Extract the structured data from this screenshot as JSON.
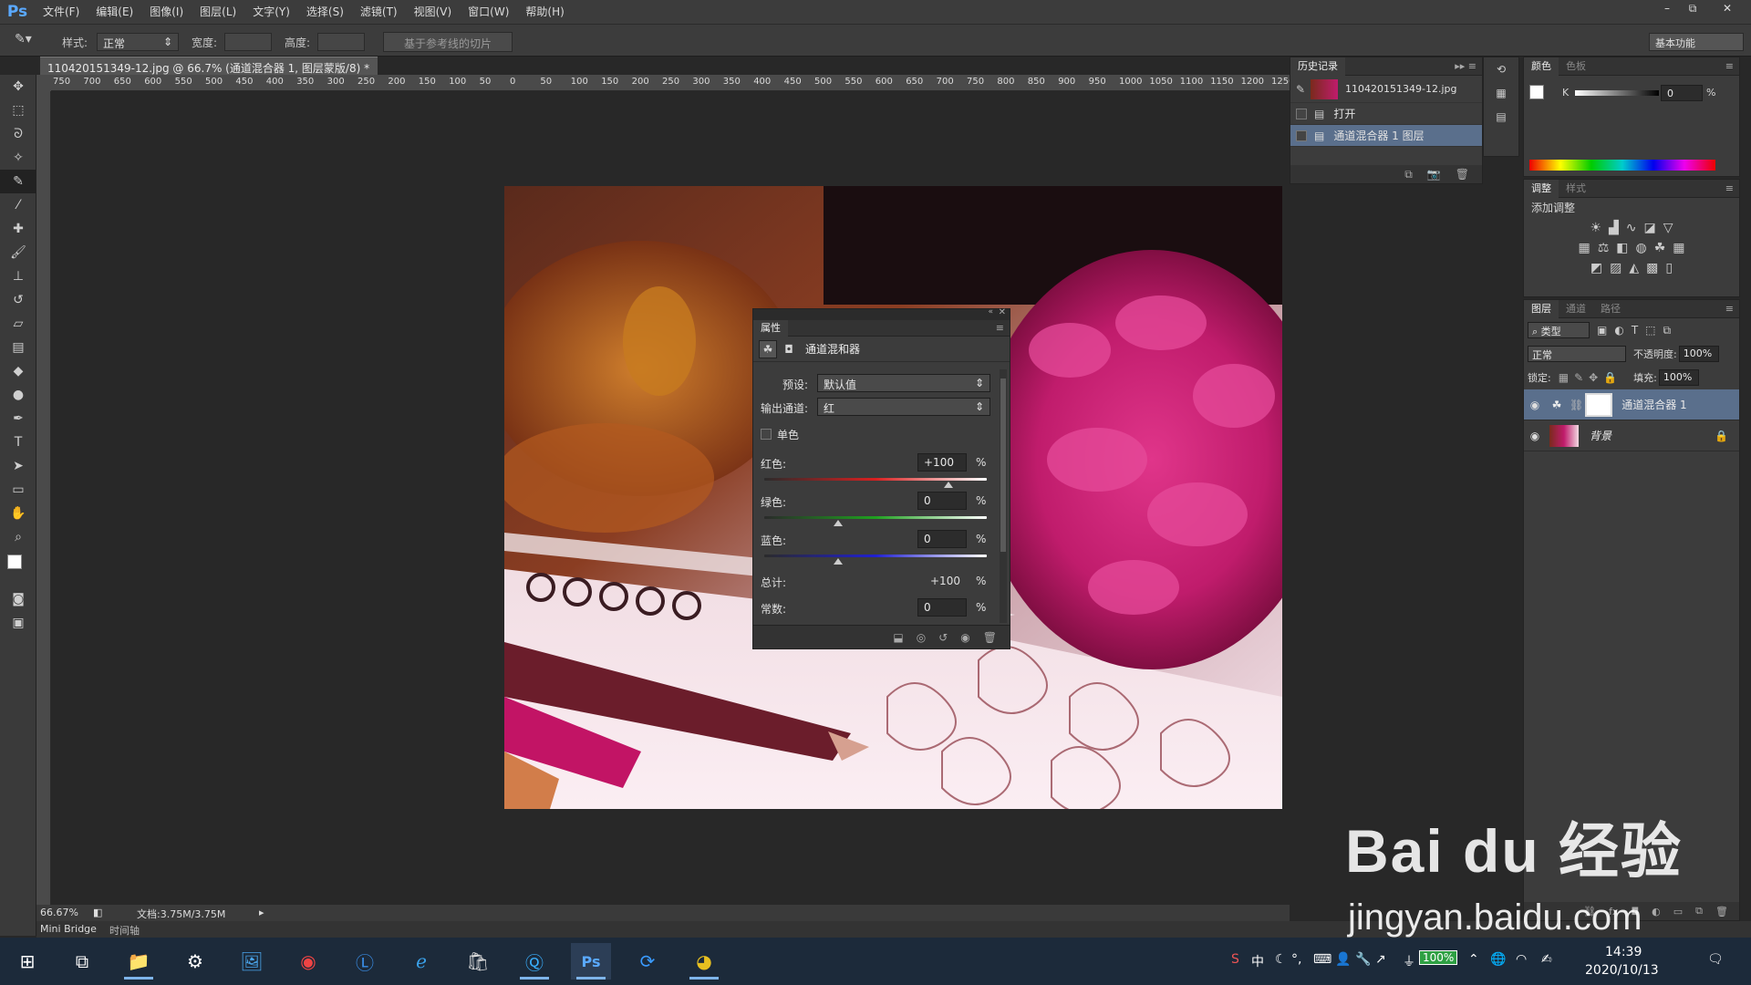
{
  "app": {
    "logo": "Ps",
    "menu": [
      "文件(F)",
      "编辑(E)",
      "图像(I)",
      "图层(L)",
      "文字(Y)",
      "选择(S)",
      "滤镜(T)",
      "视图(V)",
      "窗口(W)",
      "帮助(H)"
    ],
    "window_controls": [
      "–",
      "⧉",
      "✕"
    ]
  },
  "options_bar": {
    "style_label": "样式:",
    "style_value": "正常",
    "width_label": "宽度:",
    "height_label": "高度:",
    "slice_button": "基于参考线的切片",
    "workspace": "基本功能"
  },
  "document": {
    "tab_title": "110420151349-12.jpg @ 66.7% (通道混合器 1, 图层蒙版/8) *",
    "zoom": "66.67%",
    "doc_size": "文档:3.75M/3.75M"
  },
  "ruler": {
    "h_labels": [
      "750",
      "700",
      "650",
      "600",
      "550",
      "500",
      "450",
      "400",
      "350",
      "300",
      "250",
      "200",
      "150",
      "100",
      "50",
      "0",
      "50",
      "100",
      "150",
      "200",
      "250",
      "300",
      "350",
      "400",
      "450",
      "500",
      "550",
      "600",
      "650",
      "700",
      "750",
      "800",
      "850",
      "900",
      "950",
      "1000",
      "1050",
      "1100",
      "1150",
      "1200",
      "1250"
    ]
  },
  "history": {
    "tab": "历史记录",
    "snapshot": "110420151349-12.jpg",
    "items": [
      "打开",
      "通道混合器 1 图层"
    ]
  },
  "color_panel": {
    "tabs": [
      "颜色",
      "色板"
    ],
    "channel_label": "K",
    "value": "0",
    "unit": "%"
  },
  "adjustments": {
    "tabs": [
      "调整",
      "样式"
    ],
    "add_label": "添加调整"
  },
  "layers_panel": {
    "tabs": [
      "图层",
      "通道",
      "路径"
    ],
    "filter": "类型",
    "blend_mode": "正常",
    "opacity_label": "不透明度:",
    "opacity": "100%",
    "lock_label": "锁定:",
    "fill_label": "填充:",
    "fill": "100%",
    "layers": [
      {
        "name": "通道混合器 1"
      },
      {
        "name": "背景"
      }
    ]
  },
  "properties": {
    "tab": "属性",
    "title": "通道混和器",
    "preset_label": "预设:",
    "preset_value": "默认值",
    "output_label": "输出通道:",
    "output_value": "红",
    "mono_label": "单色",
    "red_label": "红色:",
    "red_value": "+100",
    "green_label": "绿色:",
    "green_value": "0",
    "blue_label": "蓝色:",
    "blue_value": "0",
    "total_label": "总计:",
    "total_value": "+100",
    "constant_label": "常数:",
    "constant_value": "0",
    "pct": "%",
    "red_level": 1.0,
    "green_level": 0.5,
    "blue_level": 0.5
  },
  "bottom_tabs": [
    "Mini Bridge",
    "时间轴"
  ],
  "taskbar": {
    "battery": "100%",
    "ime": "中",
    "time": "14:39",
    "date": "2020/10/13"
  },
  "watermark": {
    "brand": "Bai du 经验",
    "url": "jingyan.baidu.com"
  }
}
